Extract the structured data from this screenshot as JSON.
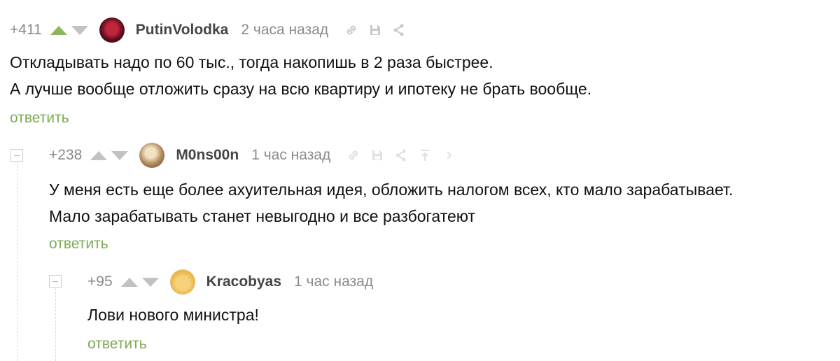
{
  "comments": [
    {
      "rating": "+411",
      "author": "PutinVolodka",
      "time": "2 часа назад",
      "lines": [
        "Откладывать надо по 60 тыс., тогда накопишь в 2 раза быстрее.",
        "А лучше вообще отложить сразу на всю квартиру и ипотеку не брать вообще."
      ],
      "reply": "ответить",
      "avatar_color": "#7a1024",
      "upvoted": true
    },
    {
      "rating": "+238",
      "author": "M0ns00n",
      "time": "1 час назад",
      "lines": [
        "У меня есть еще более ахуительная идея, обложить налогом всех, кто мало зарабатывает.",
        "Мало зарабатывать станет невыгодно и все разбогатеют"
      ],
      "reply": "ответить",
      "avatar_color": "#b08a5a",
      "upvoted": false
    },
    {
      "rating": "+95",
      "author": "Kracobyas",
      "time": "1 час назад",
      "lines": [
        "Лови нового министра!"
      ],
      "reply": "ответить",
      "avatar_color": "#f2c46a",
      "upvoted": false
    }
  ],
  "colors": {
    "accent_green": "#7dab55",
    "upvote_active": "#8ab65d",
    "muted": "#8a8a8a"
  }
}
